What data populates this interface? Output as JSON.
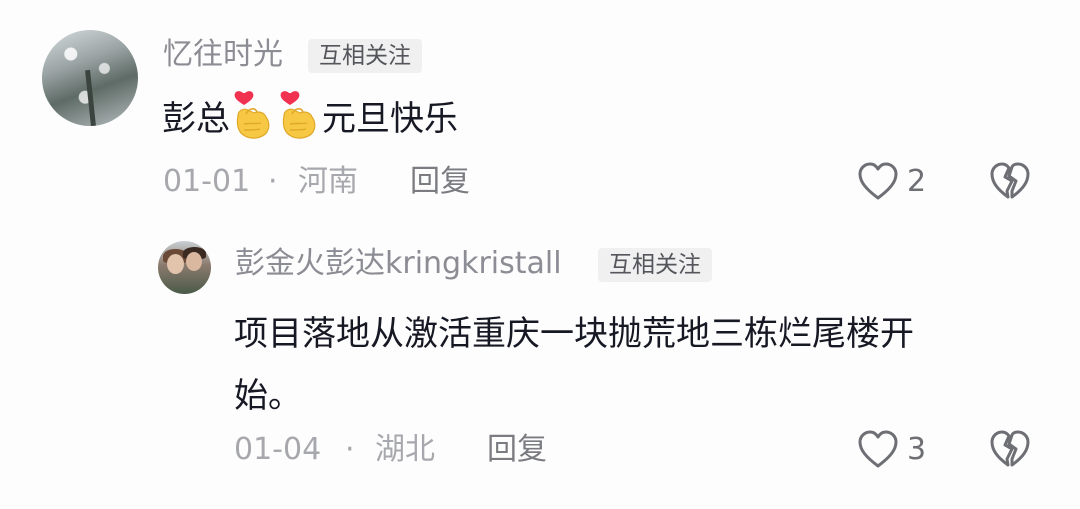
{
  "comments": [
    {
      "username": "忆往时光",
      "tag": "互相关注",
      "text_before": "彭总",
      "emoji_1": "finger-heart-emoji",
      "emoji_2": "finger-heart-emoji",
      "text_after": "元旦快乐",
      "date": "01-01",
      "separator": "·",
      "location": "河南",
      "reply_label": "回复",
      "likes": "2"
    }
  ],
  "replies": [
    {
      "username": "彭金火彭达kringkristall",
      "tag": "互相关注",
      "text_line_1": "项目落地从激活重庆一块抛荒地三栋烂尾楼开",
      "text_line_2": "始。",
      "date": "01-04",
      "separator": "·",
      "location": "湖北",
      "reply_label": "回复",
      "likes": "3"
    }
  ],
  "icons": {
    "like": "heart-outline-icon",
    "dislike": "broken-heart-icon",
    "emoji": "finger-heart-emoji"
  },
  "colors": {
    "primary_text": "#161823",
    "secondary_text": "#8c8c94",
    "tag_bg": "#f0f0f1",
    "emoji_heart": "#f0314f",
    "emoji_hand": "#f7c843"
  }
}
